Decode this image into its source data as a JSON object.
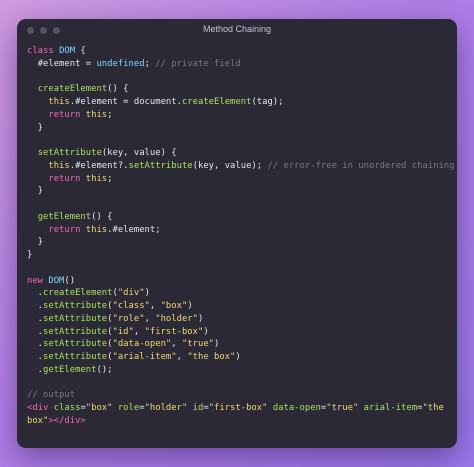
{
  "window": {
    "title": "Method Chaining",
    "controls": [
      "close-dot",
      "minimize-dot",
      "zoom-dot"
    ]
  },
  "colors": {
    "background_gradient": [
      "#cf9be0",
      "#9a78ea"
    ],
    "window_bg": "#2b2936",
    "keyword": "#f067b6",
    "class_name": "#7fd6ff",
    "function": "#a9e25c",
    "string": "#f2d871",
    "comment": "#7b7789",
    "text": "#e8e6ee"
  },
  "code_lines": [
    [
      [
        "kw",
        "class"
      ],
      [
        "punc",
        " "
      ],
      [
        "cls",
        "DOM"
      ],
      [
        "punc",
        " {"
      ]
    ],
    [
      [
        "punc",
        "  "
      ],
      [
        "prop",
        "#element"
      ],
      [
        "punc",
        " = "
      ],
      [
        "cls",
        "undefined"
      ],
      [
        "punc",
        "; "
      ],
      [
        "cm",
        "// private field"
      ]
    ],
    [],
    [
      [
        "punc",
        "  "
      ],
      [
        "fn",
        "createElement"
      ],
      [
        "punc",
        "() {"
      ]
    ],
    [
      [
        "punc",
        "    "
      ],
      [
        "this",
        "this"
      ],
      [
        "punc",
        "."
      ],
      [
        "prop",
        "#element"
      ],
      [
        "punc",
        " = "
      ],
      [
        "prop",
        "document"
      ],
      [
        "punc",
        "."
      ],
      [
        "fn",
        "createElement"
      ],
      [
        "punc",
        "(tag);"
      ]
    ],
    [
      [
        "punc",
        "    "
      ],
      [
        "kw",
        "return"
      ],
      [
        "punc",
        " "
      ],
      [
        "this",
        "this"
      ],
      [
        "punc",
        ";"
      ]
    ],
    [
      [
        "punc",
        "  }"
      ]
    ],
    [],
    [
      [
        "punc",
        "  "
      ],
      [
        "fn",
        "setAttribute"
      ],
      [
        "punc",
        "(key, value) {"
      ]
    ],
    [
      [
        "punc",
        "    "
      ],
      [
        "this",
        "this"
      ],
      [
        "punc",
        "."
      ],
      [
        "prop",
        "#element"
      ],
      [
        "punc",
        "?."
      ],
      [
        "fn",
        "setAttribute"
      ],
      [
        "punc",
        "(key, value); "
      ],
      [
        "cm",
        "// error-free in unordered chaining"
      ]
    ],
    [
      [
        "punc",
        "    "
      ],
      [
        "kw",
        "return"
      ],
      [
        "punc",
        " "
      ],
      [
        "this",
        "this"
      ],
      [
        "punc",
        ";"
      ]
    ],
    [
      [
        "punc",
        "  }"
      ]
    ],
    [],
    [
      [
        "punc",
        "  "
      ],
      [
        "fn",
        "getElement"
      ],
      [
        "punc",
        "() {"
      ]
    ],
    [
      [
        "punc",
        "    "
      ],
      [
        "kw",
        "return"
      ],
      [
        "punc",
        " "
      ],
      [
        "this",
        "this"
      ],
      [
        "punc",
        "."
      ],
      [
        "prop",
        "#element"
      ],
      [
        "punc",
        ";"
      ]
    ],
    [
      [
        "punc",
        "  }"
      ]
    ],
    [
      [
        "punc",
        "}"
      ]
    ],
    [],
    [
      [
        "kw",
        "new"
      ],
      [
        "punc",
        " "
      ],
      [
        "cls",
        "DOM"
      ],
      [
        "punc",
        "()"
      ]
    ],
    [
      [
        "punc",
        "  ."
      ],
      [
        "fn",
        "createElement"
      ],
      [
        "punc",
        "("
      ],
      [
        "str",
        "\"div\""
      ],
      [
        "punc",
        ")"
      ]
    ],
    [
      [
        "punc",
        "  ."
      ],
      [
        "fn",
        "setAttribute"
      ],
      [
        "punc",
        "("
      ],
      [
        "str",
        "\"class\""
      ],
      [
        "punc",
        ", "
      ],
      [
        "str",
        "\"box\""
      ],
      [
        "punc",
        ")"
      ]
    ],
    [
      [
        "punc",
        "  ."
      ],
      [
        "fn",
        "setAttribute"
      ],
      [
        "punc",
        "("
      ],
      [
        "str",
        "\"role\""
      ],
      [
        "punc",
        ", "
      ],
      [
        "str",
        "\"holder\""
      ],
      [
        "punc",
        ")"
      ]
    ],
    [
      [
        "punc",
        "  ."
      ],
      [
        "fn",
        "setAttribute"
      ],
      [
        "punc",
        "("
      ],
      [
        "str",
        "\"id\""
      ],
      [
        "punc",
        ", "
      ],
      [
        "str",
        "\"first-box\""
      ],
      [
        "punc",
        ")"
      ]
    ],
    [
      [
        "punc",
        "  ."
      ],
      [
        "fn",
        "setAttribute"
      ],
      [
        "punc",
        "("
      ],
      [
        "str",
        "\"data-open\""
      ],
      [
        "punc",
        ", "
      ],
      [
        "str",
        "\"true\""
      ],
      [
        "punc",
        ")"
      ]
    ],
    [
      [
        "punc",
        "  ."
      ],
      [
        "fn",
        "setAttribute"
      ],
      [
        "punc",
        "("
      ],
      [
        "str",
        "\"arial-item\""
      ],
      [
        "punc",
        ", "
      ],
      [
        "str",
        "\"the box\""
      ],
      [
        "punc",
        ")"
      ]
    ],
    [
      [
        "punc",
        "  ."
      ],
      [
        "fn",
        "getElement"
      ],
      [
        "punc",
        "();"
      ]
    ],
    [],
    [
      [
        "cm",
        "// output"
      ]
    ],
    [
      [
        "kw",
        "<div"
      ],
      [
        "punc",
        " "
      ],
      [
        "fn",
        "class"
      ],
      [
        "punc",
        "="
      ],
      [
        "str",
        "\"box\""
      ],
      [
        "punc",
        " "
      ],
      [
        "fn",
        "role"
      ],
      [
        "punc",
        "="
      ],
      [
        "str",
        "\"holder\""
      ],
      [
        "punc",
        " "
      ],
      [
        "fn",
        "id"
      ],
      [
        "punc",
        "="
      ],
      [
        "str",
        "\"first-box\""
      ],
      [
        "punc",
        " "
      ],
      [
        "fn",
        "data-open"
      ],
      [
        "punc",
        "="
      ],
      [
        "str",
        "\"true\""
      ],
      [
        "punc",
        " "
      ],
      [
        "fn",
        "arial-item"
      ],
      [
        "punc",
        "="
      ],
      [
        "str",
        "\"the"
      ]
    ],
    [
      [
        "str",
        "box\""
      ],
      [
        "kw",
        "></div>"
      ]
    ]
  ]
}
